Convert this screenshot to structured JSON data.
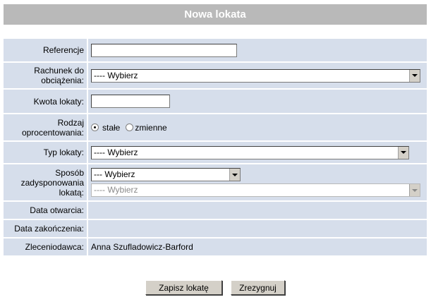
{
  "form": {
    "title": "Nowa lokata",
    "reference": {
      "label": "Referencje",
      "value": ""
    },
    "debit_account": {
      "label_line1": "Rachunek do",
      "label_line2": "obciążenia:",
      "selected": "---- Wybierz"
    },
    "amount": {
      "label": "Kwota lokaty:",
      "value": ""
    },
    "interest_type": {
      "label_line1": "Rodzaj",
      "label_line2": "oprocentowania:",
      "options": [
        {
          "label": "stałe",
          "checked": true
        },
        {
          "label": "zmienne",
          "checked": false
        }
      ]
    },
    "deposit_type": {
      "label": "Typ lokaty:",
      "selected": "---- Wybierz"
    },
    "disposition": {
      "label_line1": "Sposób",
      "label_line2": "zadysponowania",
      "label_line3": "lokatą:",
      "primary_selected": "--- Wybierz",
      "secondary_selected": "---- Wybierz"
    },
    "open_date": {
      "label": "Data otwarcia:",
      "value": ""
    },
    "close_date": {
      "label": "Data zakończenia:",
      "value": ""
    },
    "orderer": {
      "label": "Zleceniodawca:",
      "value": "Anna Szufladowicz-Barford"
    }
  },
  "buttons": {
    "save": "Zapisz lokatę",
    "cancel": "Zrezygnuj"
  }
}
